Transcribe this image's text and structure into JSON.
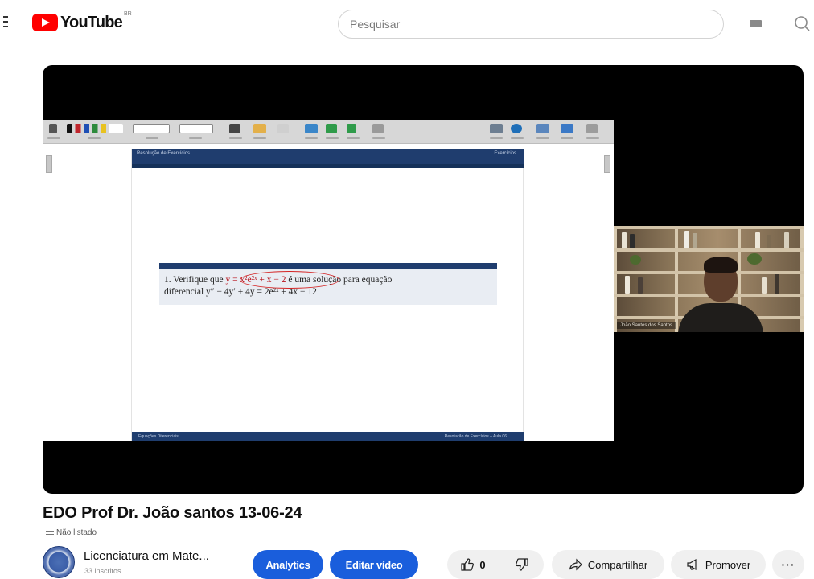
{
  "masthead": {
    "logo_text": "YouTube",
    "logo_superscript": "BR",
    "search": {
      "placeholder": "Pesquisar",
      "value": ""
    },
    "icons": [
      "menu-icon",
      "keyboard-icon",
      "search-icon"
    ]
  },
  "player": {
    "slide": {
      "header_left": "Resolução de Exercícios",
      "header_right": "Exercícios",
      "exercise_line1_prefix": "1. Verifique que",
      "exercise_line1_formula": "y = x²e²ˣ + x − 2",
      "exercise_line1_suffix": "é uma solução para equação",
      "exercise_line2": "diferencial y″ − 4y′ + 4y = 2e²ˣ + 4x − 12",
      "footer_left": "Equações Diferenciais",
      "footer_right": "Resolução de Exercícios – Aula 06"
    },
    "webcam": {
      "name_label": "João Santos dos Santos"
    }
  },
  "video": {
    "title": "EDO Prof Dr. João santos 13-06-24",
    "visibility": "Não listado"
  },
  "channel": {
    "name": "Licenciatura em Mate...",
    "subscribers": "33 inscritos"
  },
  "actions": {
    "analytics_label": "Analytics",
    "edit_label": "Editar vídeo",
    "like_count": "0",
    "share_label": "Compartilhar",
    "promote_label": "Promover",
    "more_label": "···"
  },
  "colors": {
    "brand_red": "#ff0000",
    "action_blue": "#1a5edc",
    "slide_navy": "#1f3d6e",
    "annotation_red": "#d42424"
  }
}
